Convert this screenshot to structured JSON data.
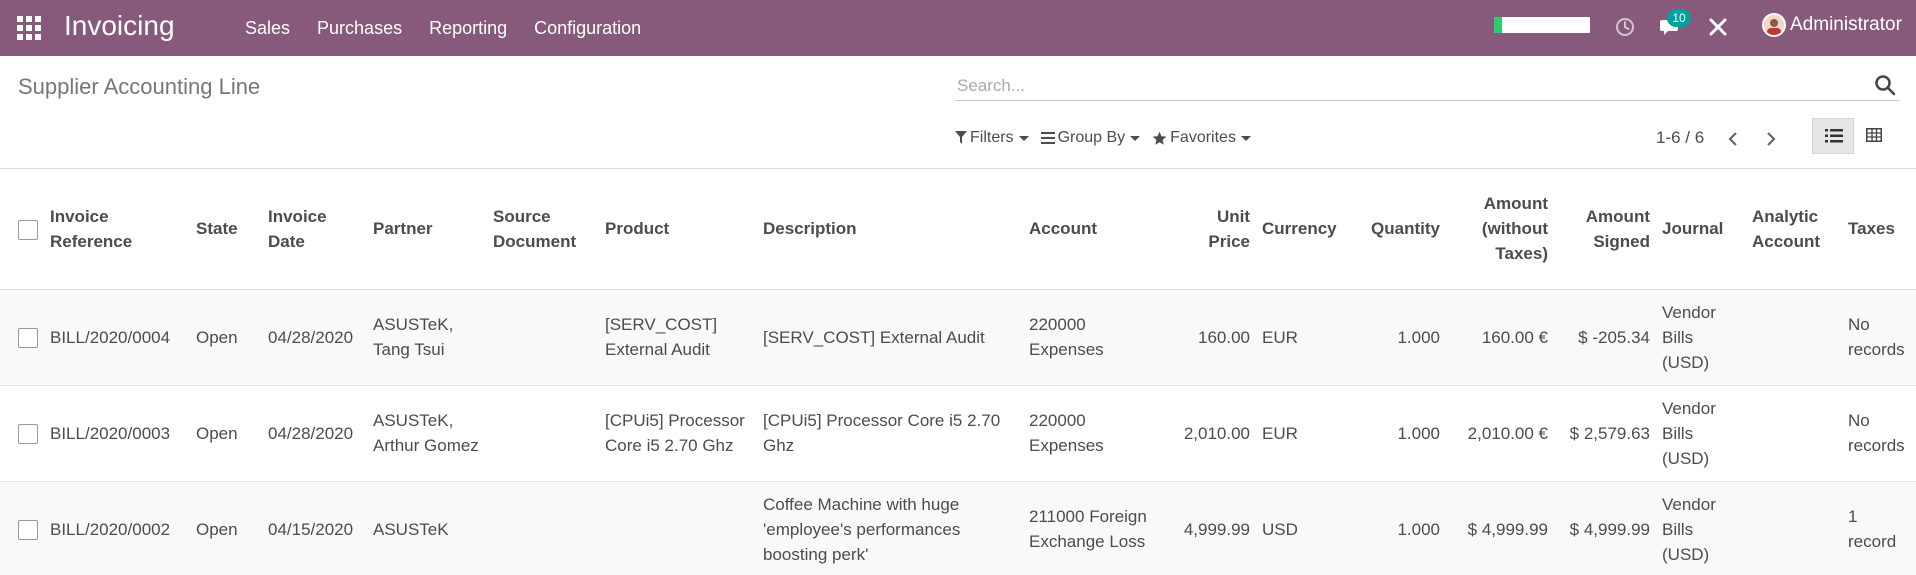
{
  "navbar": {
    "app_title": "Invoicing",
    "menu": [
      "Sales",
      "Purchases",
      "Reporting",
      "Configuration"
    ],
    "messages_badge": "10",
    "user_name": "Administrator",
    "progress_fraction": 0.08,
    "colors": {
      "bar": "#875a7b",
      "badge": "#00a09d",
      "progress": "#2ecc71"
    },
    "icons": [
      "apps-grid-icon",
      "clock-icon",
      "chat-icon",
      "tools-icon",
      "avatar"
    ]
  },
  "control_panel": {
    "title": "Supplier Accounting Line",
    "search_placeholder": "Search...",
    "filters_label": "Filters",
    "group_by_label": "Group By",
    "favorites_label": "Favorites",
    "pager": "1-6 / 6"
  },
  "table": {
    "columns": {
      "ref_1": "Invoice",
      "ref_2": "Reference",
      "state": "State",
      "date_1": "Invoice",
      "date_2": "Date",
      "partner": "Partner",
      "source_1": "Source",
      "source_2": "Document",
      "product": "Product",
      "description": "Description",
      "account": "Account",
      "unit_1": "Unit",
      "unit_2": "Price",
      "currency": "Currency",
      "quantity": "Quantity",
      "amount_1": "Amount",
      "amount_2": "(without",
      "amount_3": "Taxes)",
      "signed_1": "Amount",
      "signed_2": "Signed",
      "journal": "Journal",
      "analytic_1": "Analytic",
      "analytic_2": "Account",
      "taxes": "Taxes"
    },
    "rows": [
      {
        "ref": "BILL/2020/0004",
        "state": "Open",
        "date": "04/28/2020",
        "partner_1": "ASUSTeK,",
        "partner_2": "Tang Tsui",
        "source": "",
        "product_1": "[SERV_COST]",
        "product_2": "External Audit",
        "desc_1": "[SERV_COST] External Audit",
        "desc_2": "",
        "desc_3": "",
        "account_1": "220000",
        "account_2": "Expenses",
        "unit_price": "160.00",
        "currency": "EUR",
        "quantity": "1.000",
        "amount": "160.00 €",
        "signed": "$ -205.34",
        "journal_1": "Vendor",
        "journal_2": "Bills",
        "journal_3": "(USD)",
        "analytic": "",
        "taxes_1": "No",
        "taxes_2": "records"
      },
      {
        "ref": "BILL/2020/0003",
        "state": "Open",
        "date": "04/28/2020",
        "partner_1": "ASUSTeK,",
        "partner_2": "Arthur Gomez",
        "source": "",
        "product_1": "[CPUi5] Processor",
        "product_2": "Core i5 2.70 Ghz",
        "desc_1": "[CPUi5] Processor Core i5 2.70",
        "desc_2": "Ghz",
        "desc_3": "",
        "account_1": "220000",
        "account_2": "Expenses",
        "unit_price": "2,010.00",
        "currency": "EUR",
        "quantity": "1.000",
        "amount": "2,010.00 €",
        "signed": "$ 2,579.63",
        "journal_1": "Vendor",
        "journal_2": "Bills",
        "journal_3": "(USD)",
        "analytic": "",
        "taxes_1": "No",
        "taxes_2": "records"
      },
      {
        "ref": "BILL/2020/0002",
        "state": "Open",
        "date": "04/15/2020",
        "partner_1": "ASUSTeK",
        "partner_2": "",
        "source": "",
        "product_1": "",
        "product_2": "",
        "desc_1": "Coffee Machine with huge",
        "desc_2": "'employee's performances",
        "desc_3": "boosting perk'",
        "account_1": "211000 Foreign",
        "account_2": "Exchange Loss",
        "unit_price": "4,999.99",
        "currency": "USD",
        "quantity": "1.000",
        "amount": "$ 4,999.99",
        "signed": "$ 4,999.99",
        "journal_1": "Vendor",
        "journal_2": "Bills",
        "journal_3": "(USD)",
        "analytic": "",
        "taxes_1": "1",
        "taxes_2": "record"
      }
    ]
  }
}
